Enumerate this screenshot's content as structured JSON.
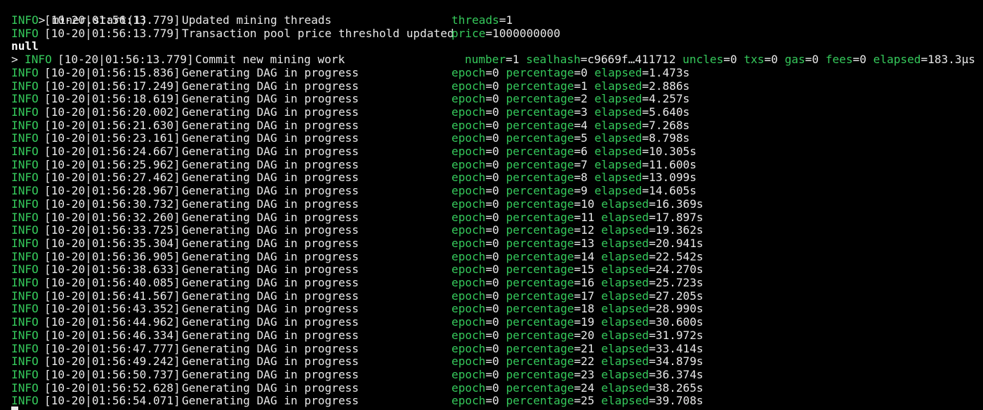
{
  "colors": {
    "background": "#000000",
    "text": "#e8e8e8",
    "accent_green": "#35c95b"
  },
  "terminal": {
    "command": "> miner.start(1)",
    "prompt_prefix": ">",
    "lines": [
      {
        "kind": "info",
        "level": "INFO",
        "timestamp": "[10-20|01:56:13.779]",
        "message": "Updated mining threads",
        "fields": [
          {
            "key": "threads",
            "value": "1"
          }
        ]
      },
      {
        "kind": "info",
        "level": "INFO",
        "timestamp": "[10-20|01:56:13.779]",
        "message": "Transaction pool price threshold updated",
        "fields": [
          {
            "key": "price",
            "value": "1000000000"
          }
        ]
      },
      {
        "kind": "result",
        "text": "null"
      },
      {
        "kind": "info",
        "prompt": true,
        "level": "INFO",
        "timestamp": "[10-20|01:56:13.779]",
        "message": "Commit new mining work",
        "fields": [
          {
            "key": "number",
            "value": "1"
          },
          {
            "key": "sealhash",
            "value": "c9669f…411712"
          },
          {
            "key": "uncles",
            "value": "0"
          },
          {
            "key": "txs",
            "value": "0"
          },
          {
            "key": "gas",
            "value": "0"
          },
          {
            "key": "fees",
            "value": "0"
          },
          {
            "key": "elapsed",
            "value": "183.3µs"
          }
        ]
      },
      {
        "kind": "dag",
        "level": "INFO",
        "timestamp": "[10-20|01:56:15.836]",
        "message": "Generating DAG in progress",
        "fields": [
          {
            "key": "epoch",
            "value": "0"
          },
          {
            "key": "percentage",
            "value": "0"
          },
          {
            "key": "elapsed",
            "value": "1.473s"
          }
        ]
      },
      {
        "kind": "dag",
        "level": "INFO",
        "timestamp": "[10-20|01:56:17.249]",
        "message": "Generating DAG in progress",
        "fields": [
          {
            "key": "epoch",
            "value": "0"
          },
          {
            "key": "percentage",
            "value": "1"
          },
          {
            "key": "elapsed",
            "value": "2.886s"
          }
        ]
      },
      {
        "kind": "dag",
        "level": "INFO",
        "timestamp": "[10-20|01:56:18.619]",
        "message": "Generating DAG in progress",
        "fields": [
          {
            "key": "epoch",
            "value": "0"
          },
          {
            "key": "percentage",
            "value": "2"
          },
          {
            "key": "elapsed",
            "value": "4.257s"
          }
        ]
      },
      {
        "kind": "dag",
        "level": "INFO",
        "timestamp": "[10-20|01:56:20.002]",
        "message": "Generating DAG in progress",
        "fields": [
          {
            "key": "epoch",
            "value": "0"
          },
          {
            "key": "percentage",
            "value": "3"
          },
          {
            "key": "elapsed",
            "value": "5.640s"
          }
        ]
      },
      {
        "kind": "dag",
        "level": "INFO",
        "timestamp": "[10-20|01:56:21.630]",
        "message": "Generating DAG in progress",
        "fields": [
          {
            "key": "epoch",
            "value": "0"
          },
          {
            "key": "percentage",
            "value": "4"
          },
          {
            "key": "elapsed",
            "value": "7.268s"
          }
        ]
      },
      {
        "kind": "dag",
        "level": "INFO",
        "timestamp": "[10-20|01:56:23.161]",
        "message": "Generating DAG in progress",
        "fields": [
          {
            "key": "epoch",
            "value": "0"
          },
          {
            "key": "percentage",
            "value": "5"
          },
          {
            "key": "elapsed",
            "value": "8.798s"
          }
        ]
      },
      {
        "kind": "dag",
        "level": "INFO",
        "timestamp": "[10-20|01:56:24.667]",
        "message": "Generating DAG in progress",
        "fields": [
          {
            "key": "epoch",
            "value": "0"
          },
          {
            "key": "percentage",
            "value": "6"
          },
          {
            "key": "elapsed",
            "value": "10.305s"
          }
        ]
      },
      {
        "kind": "dag",
        "level": "INFO",
        "timestamp": "[10-20|01:56:25.962]",
        "message": "Generating DAG in progress",
        "fields": [
          {
            "key": "epoch",
            "value": "0"
          },
          {
            "key": "percentage",
            "value": "7"
          },
          {
            "key": "elapsed",
            "value": "11.600s"
          }
        ]
      },
      {
        "kind": "dag",
        "level": "INFO",
        "timestamp": "[10-20|01:56:27.462]",
        "message": "Generating DAG in progress",
        "fields": [
          {
            "key": "epoch",
            "value": "0"
          },
          {
            "key": "percentage",
            "value": "8"
          },
          {
            "key": "elapsed",
            "value": "13.099s"
          }
        ]
      },
      {
        "kind": "dag",
        "level": "INFO",
        "timestamp": "[10-20|01:56:28.967]",
        "message": "Generating DAG in progress",
        "fields": [
          {
            "key": "epoch",
            "value": "0"
          },
          {
            "key": "percentage",
            "value": "9"
          },
          {
            "key": "elapsed",
            "value": "14.605s"
          }
        ]
      },
      {
        "kind": "dag",
        "level": "INFO",
        "timestamp": "[10-20|01:56:30.732]",
        "message": "Generating DAG in progress",
        "fields": [
          {
            "key": "epoch",
            "value": "0"
          },
          {
            "key": "percentage",
            "value": "10"
          },
          {
            "key": "elapsed",
            "value": "16.369s"
          }
        ]
      },
      {
        "kind": "dag",
        "level": "INFO",
        "timestamp": "[10-20|01:56:32.260]",
        "message": "Generating DAG in progress",
        "fields": [
          {
            "key": "epoch",
            "value": "0"
          },
          {
            "key": "percentage",
            "value": "11"
          },
          {
            "key": "elapsed",
            "value": "17.897s"
          }
        ]
      },
      {
        "kind": "dag",
        "level": "INFO",
        "timestamp": "[10-20|01:56:33.725]",
        "message": "Generating DAG in progress",
        "fields": [
          {
            "key": "epoch",
            "value": "0"
          },
          {
            "key": "percentage",
            "value": "12"
          },
          {
            "key": "elapsed",
            "value": "19.362s"
          }
        ]
      },
      {
        "kind": "dag",
        "level": "INFO",
        "timestamp": "[10-20|01:56:35.304]",
        "message": "Generating DAG in progress",
        "fields": [
          {
            "key": "epoch",
            "value": "0"
          },
          {
            "key": "percentage",
            "value": "13"
          },
          {
            "key": "elapsed",
            "value": "20.941s"
          }
        ]
      },
      {
        "kind": "dag",
        "level": "INFO",
        "timestamp": "[10-20|01:56:36.905]",
        "message": "Generating DAG in progress",
        "fields": [
          {
            "key": "epoch",
            "value": "0"
          },
          {
            "key": "percentage",
            "value": "14"
          },
          {
            "key": "elapsed",
            "value": "22.542s"
          }
        ]
      },
      {
        "kind": "dag",
        "level": "INFO",
        "timestamp": "[10-20|01:56:38.633]",
        "message": "Generating DAG in progress",
        "fields": [
          {
            "key": "epoch",
            "value": "0"
          },
          {
            "key": "percentage",
            "value": "15"
          },
          {
            "key": "elapsed",
            "value": "24.270s"
          }
        ]
      },
      {
        "kind": "dag",
        "level": "INFO",
        "timestamp": "[10-20|01:56:40.085]",
        "message": "Generating DAG in progress",
        "fields": [
          {
            "key": "epoch",
            "value": "0"
          },
          {
            "key": "percentage",
            "value": "16"
          },
          {
            "key": "elapsed",
            "value": "25.723s"
          }
        ]
      },
      {
        "kind": "dag",
        "level": "INFO",
        "timestamp": "[10-20|01:56:41.567]",
        "message": "Generating DAG in progress",
        "fields": [
          {
            "key": "epoch",
            "value": "0"
          },
          {
            "key": "percentage",
            "value": "17"
          },
          {
            "key": "elapsed",
            "value": "27.205s"
          }
        ]
      },
      {
        "kind": "dag",
        "level": "INFO",
        "timestamp": "[10-20|01:56:43.352]",
        "message": "Generating DAG in progress",
        "fields": [
          {
            "key": "epoch",
            "value": "0"
          },
          {
            "key": "percentage",
            "value": "18"
          },
          {
            "key": "elapsed",
            "value": "28.990s"
          }
        ]
      },
      {
        "kind": "dag",
        "level": "INFO",
        "timestamp": "[10-20|01:56:44.962]",
        "message": "Generating DAG in progress",
        "fields": [
          {
            "key": "epoch",
            "value": "0"
          },
          {
            "key": "percentage",
            "value": "19"
          },
          {
            "key": "elapsed",
            "value": "30.600s"
          }
        ]
      },
      {
        "kind": "dag",
        "level": "INFO",
        "timestamp": "[10-20|01:56:46.334]",
        "message": "Generating DAG in progress",
        "fields": [
          {
            "key": "epoch",
            "value": "0"
          },
          {
            "key": "percentage",
            "value": "20"
          },
          {
            "key": "elapsed",
            "value": "31.972s"
          }
        ]
      },
      {
        "kind": "dag",
        "level": "INFO",
        "timestamp": "[10-20|01:56:47.777]",
        "message": "Generating DAG in progress",
        "fields": [
          {
            "key": "epoch",
            "value": "0"
          },
          {
            "key": "percentage",
            "value": "21"
          },
          {
            "key": "elapsed",
            "value": "33.414s"
          }
        ]
      },
      {
        "kind": "dag",
        "level": "INFO",
        "timestamp": "[10-20|01:56:49.242]",
        "message": "Generating DAG in progress",
        "fields": [
          {
            "key": "epoch",
            "value": "0"
          },
          {
            "key": "percentage",
            "value": "22"
          },
          {
            "key": "elapsed",
            "value": "34.879s"
          }
        ]
      },
      {
        "kind": "dag",
        "level": "INFO",
        "timestamp": "[10-20|01:56:50.737]",
        "message": "Generating DAG in progress",
        "fields": [
          {
            "key": "epoch",
            "value": "0"
          },
          {
            "key": "percentage",
            "value": "23"
          },
          {
            "key": "elapsed",
            "value": "36.374s"
          }
        ]
      },
      {
        "kind": "dag",
        "level": "INFO",
        "timestamp": "[10-20|01:56:52.628]",
        "message": "Generating DAG in progress",
        "fields": [
          {
            "key": "epoch",
            "value": "0"
          },
          {
            "key": "percentage",
            "value": "24"
          },
          {
            "key": "elapsed",
            "value": "38.265s"
          }
        ]
      },
      {
        "kind": "dag",
        "level": "INFO",
        "timestamp": "[10-20|01:56:54.071]",
        "message": "Generating DAG in progress",
        "fields": [
          {
            "key": "epoch",
            "value": "0"
          },
          {
            "key": "percentage",
            "value": "25"
          },
          {
            "key": "elapsed",
            "value": "39.708s"
          }
        ]
      }
    ]
  }
}
